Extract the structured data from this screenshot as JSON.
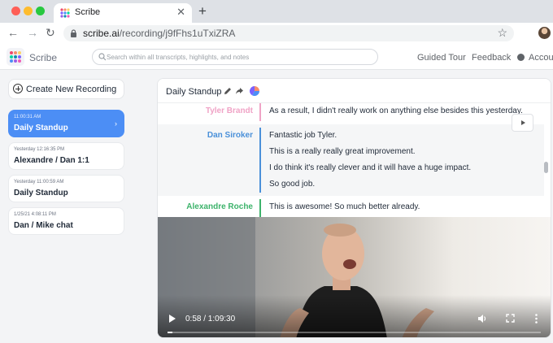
{
  "browser": {
    "tab_title": "Scribe",
    "url_domain": "scribe.ai",
    "url_path": "/recording/j9fFhs1uTxiZRA"
  },
  "header": {
    "app_name": "Scribe",
    "search_placeholder": "Search within all transcripts, highlights, and notes",
    "guided_tour": "Guided Tour",
    "feedback": "Feedback",
    "account": "Account"
  },
  "sidebar": {
    "create_label": "Create New Recording",
    "recordings": [
      {
        "time": "11:00:31 AM",
        "title": "Daily Standup",
        "active": true
      },
      {
        "time": "Yesterday 12:16:35 PM",
        "title": "Alexandre / Dan 1:1",
        "active": false
      },
      {
        "time": "Yesterday 11:00:59 AM",
        "title": "Daily Standup",
        "active": false
      },
      {
        "time": "1/25/21 4:08:11 PM",
        "title": "Dan / Mike chat",
        "active": false
      }
    ]
  },
  "recording": {
    "title": "Daily Standup"
  },
  "transcript": {
    "rows": [
      {
        "speaker": "Tyler Brandt",
        "color": "#f0a3c6",
        "lines": [
          "As a result, I didn't really work on anything else besides this yesterday."
        ]
      },
      {
        "speaker": "Dan Siroker",
        "color": "#4a90d9",
        "lines": [
          "Fantastic job Tyler.",
          "This is a really really great improvement.",
          "I do think it's really clever and it will have a huge impact.",
          "So good job."
        ]
      },
      {
        "speaker": "Alexandre Roche",
        "color": "#3db36b",
        "lines": [
          "This is awesome! So much better already."
        ]
      }
    ]
  },
  "video": {
    "current_time": "0:58",
    "total_time": "1:09:30",
    "time_display": "0:58 / 1:09:30",
    "progress": 0.014
  },
  "colors": {
    "accent": "#4c8ef5",
    "logo_dots": [
      "#ef476f",
      "#f78c6b",
      "#ffd166",
      "#06d6a0",
      "#118ab2",
      "#7b61ff",
      "#4c8ef5",
      "#9b5de5",
      "#f15bb5"
    ]
  }
}
